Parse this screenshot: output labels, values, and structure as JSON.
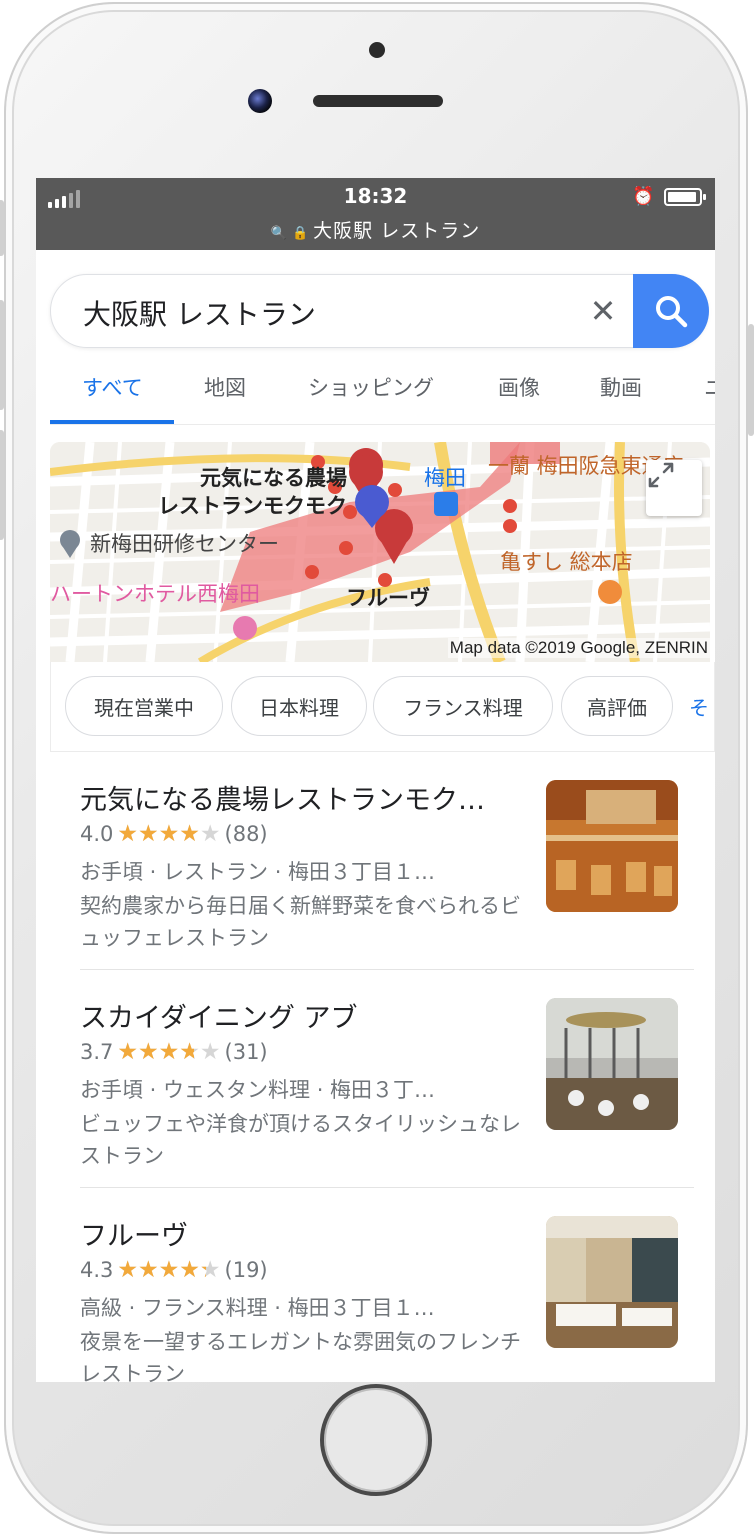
{
  "status_bar": {
    "time": "18:32",
    "url": "大阪駅 レストラン",
    "search_glyph": "🔍",
    "lock_glyph": "🔒",
    "alarm_glyph": "⏰"
  },
  "search": {
    "query": "大阪駅 レストラン",
    "clear_glyph": "✕"
  },
  "tabs": [
    {
      "label": "すべて",
      "active": true
    },
    {
      "label": "地図"
    },
    {
      "label": "ショッピング"
    },
    {
      "label": "画像"
    },
    {
      "label": "動画"
    },
    {
      "label": "ニ"
    }
  ],
  "map": {
    "labels": {
      "genki": "元気になる農場",
      "genki2": "レストランモクモク",
      "umeda": "梅田",
      "ichiran": "一蘭 梅田阪急東通店",
      "shinumeda": "新梅田研修センター",
      "kamesushi": "亀すし 総本店",
      "hearton": "ハートンホテル西梅田",
      "fleuve": "フルーヴ"
    },
    "credit": "Map data ©2019 Google, ZENRIN"
  },
  "chips": [
    {
      "label": "現在営業中"
    },
    {
      "label": "日本料理"
    },
    {
      "label": "フランス料理"
    },
    {
      "label": "高評価"
    },
    {
      "label": "そ"
    }
  ],
  "results": [
    {
      "title": "元気になる農場レストランモク…",
      "rating": "4.0",
      "rating_fraction": 0.8,
      "reviews": "(88)",
      "meta": "お手頃 · レストラン · 梅田３丁目１…",
      "desc": "契約農家から毎日届く新鮮野菜を食べられるビュッフェレストラン"
    },
    {
      "title": "スカイダイニング アブ",
      "rating": "3.7",
      "rating_fraction": 0.74,
      "reviews": "(31)",
      "meta": "お手頃 · ウェスタン料理 · 梅田３丁…",
      "desc": "ビュッフェや洋食が頂けるスタイリッシュなレストラン"
    },
    {
      "title": "フルーヴ",
      "rating": "4.3",
      "rating_fraction": 0.86,
      "reviews": "(19)",
      "meta": "高級 · フランス料理 · 梅田３丁目１…",
      "desc": "夜景を一望するエレガントな雰囲気のフレンチレストラン"
    }
  ],
  "icons": {
    "stars": "★★★★★"
  },
  "colors": {
    "accent": "#1a73e8",
    "search_button": "#4285f4",
    "star": "#f2a93b",
    "status_bar": "#595959"
  }
}
